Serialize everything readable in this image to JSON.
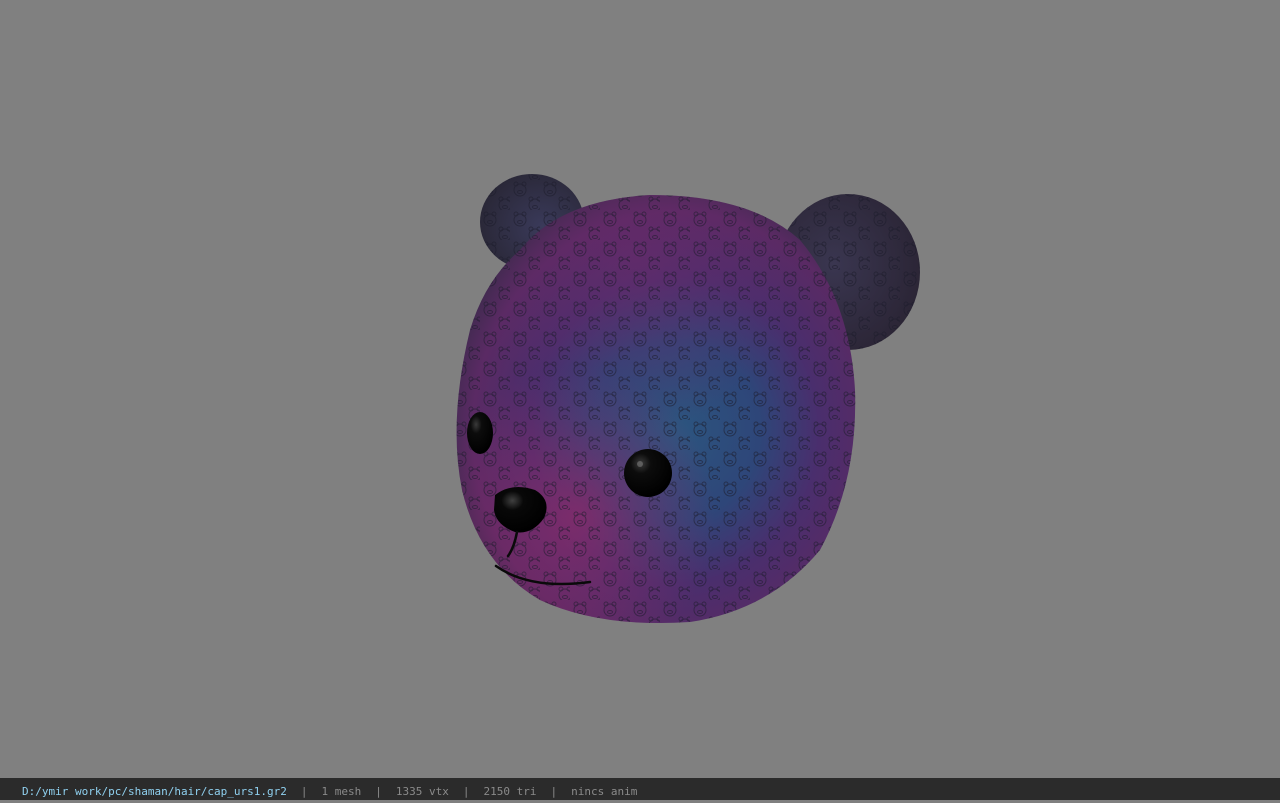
{
  "viewport": {
    "background_color": "#808080",
    "model": {
      "name": "bear-head-cap",
      "colors": {
        "purple": "#5a2a6a",
        "magenta": "#7a2a6a",
        "blue": "#2a4a7a",
        "dark": "#2e2a3e",
        "eye": "#0c0c0c",
        "nose": "#050505"
      }
    }
  },
  "status_bar": {
    "file_path": "D:/ymir work/pc/shaman/hair/cap_urs1.gr2",
    "separator": "|",
    "mesh_count": "1 mesh",
    "vertex_count": "1335 vtx",
    "triangle_count": "2150 tri",
    "anim_status": "nincs anim",
    "background_color": "#2b2b2b",
    "path_color": "#8fd0ef"
  }
}
